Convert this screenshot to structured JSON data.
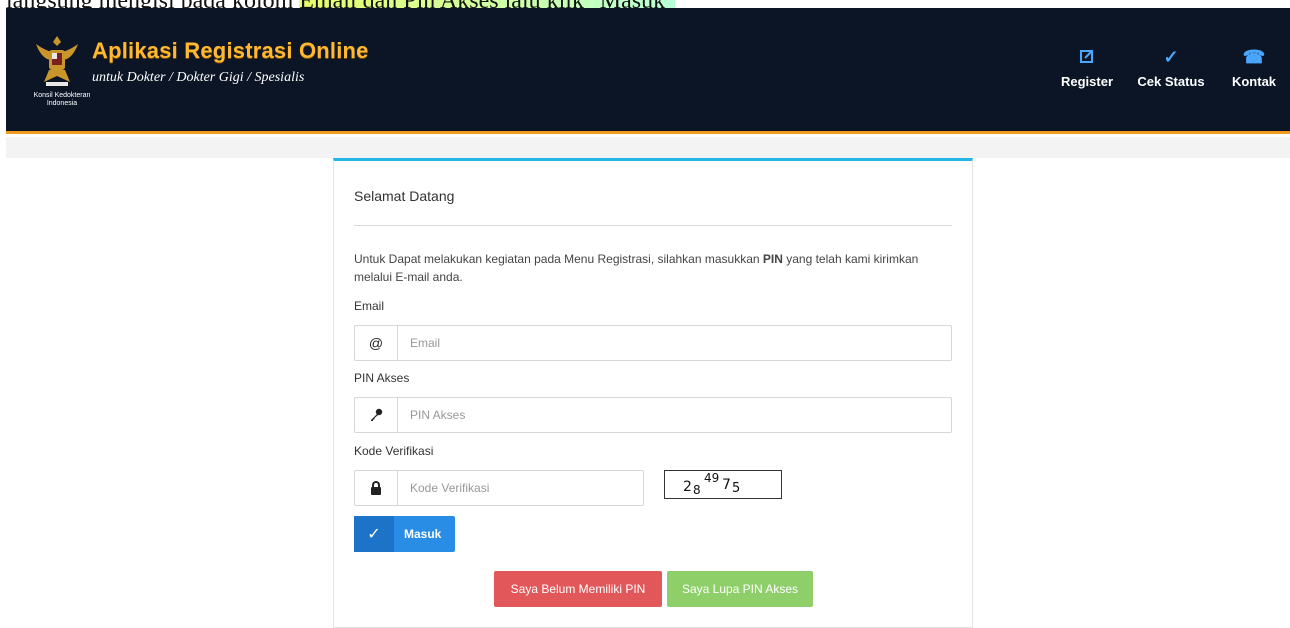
{
  "caption": {
    "text_before": "langsung mengisi pada kolom ",
    "text_highlight": "Email dan Pin Akses lalu klik \"Masuk\""
  },
  "header": {
    "emblem_caption": "Konsil Kedokteran Indonesia",
    "title": "Aplikasi Registrasi Online",
    "subtitle": "untuk Dokter / Dokter Gigi / Spesialis",
    "nav": [
      {
        "label": "Register",
        "icon": "edit-icon"
      },
      {
        "label": "Cek Status",
        "icon": "checkmark-icon"
      },
      {
        "label": "Kontak",
        "icon": "phone-icon"
      }
    ],
    "colors": {
      "bar": "#0b1526",
      "title": "#ffb830",
      "accent_line": "#f29c1f",
      "nav_icon": "#4aa7ff"
    }
  },
  "card": {
    "title": "Selamat Datang",
    "intro_before": "Untuk Dapat melakukan kegiatan pada Menu Registrasi, silahkan masukkan ",
    "intro_bold": "PIN",
    "intro_after": " yang telah kami kirimkan melalui E-mail anda.",
    "email": {
      "label": "Email",
      "placeholder": "Email",
      "icon": "at-sign-icon"
    },
    "pin": {
      "label": "PIN Akses",
      "placeholder": "PIN Akses",
      "icon": "key-icon"
    },
    "verify": {
      "label": "Kode Verifikasi",
      "placeholder": "Kode Verifikasi",
      "icon": "lock-icon"
    },
    "captcha": {
      "part1": "2",
      "part2": "8",
      "part3": "49",
      "part4": "7",
      "part5": "5"
    },
    "login_button": "Masuk",
    "no_pin_button": "Saya Belum Memiliki PIN",
    "forgot_pin_button": "Saya Lupa PIN Akses",
    "colors": {
      "top_border": "#23b7e5",
      "login": "#2a8de5",
      "danger": "#e2585a",
      "success": "#8fcf6a"
    }
  }
}
